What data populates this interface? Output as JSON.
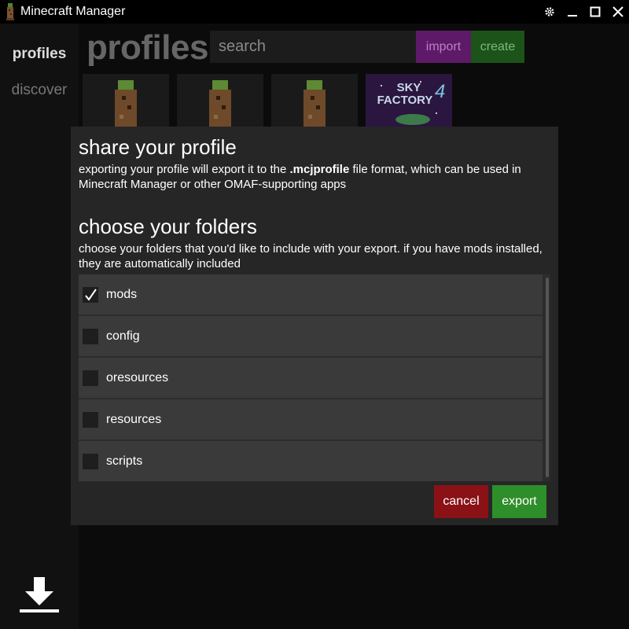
{
  "window": {
    "title": "Minecraft Manager",
    "controls": [
      "gear-icon",
      "minimize-icon",
      "maximize-icon",
      "close-icon"
    ]
  },
  "sidebar": {
    "items": [
      {
        "label": "profiles",
        "active": true
      },
      {
        "label": "discover",
        "active": false
      }
    ],
    "bottom_icon": "download-icon"
  },
  "main": {
    "heading": "profiles",
    "search_placeholder": "search",
    "import_label": "import",
    "create_label": "create",
    "tiles": [
      {
        "icon": "dirt-tree-icon"
      },
      {
        "icon": "dirt-tree-icon"
      },
      {
        "icon": "dirt-tree-icon"
      },
      {
        "icon": "sky-factory-logo",
        "logo_text": "SKY FACTORY 4"
      }
    ]
  },
  "dialog": {
    "title": "share your profile",
    "desc_prefix": "exporting your profile will export it to the ",
    "desc_bold": ".mcjprofile",
    "desc_suffix": " file format, which can be used in Minecraft Manager or other OMAF-supporting apps",
    "folders_title": "choose your folders",
    "folders_desc": "choose your folders that you'd like to include with your export. if you have mods installed, they are automatically included",
    "folders": [
      {
        "label": "mods",
        "checked": true
      },
      {
        "label": "config",
        "checked": false
      },
      {
        "label": "oresources",
        "checked": false
      },
      {
        "label": "resources",
        "checked": false
      },
      {
        "label": "scripts",
        "checked": false
      }
    ],
    "cancel_label": "cancel",
    "export_label": "export"
  },
  "colors": {
    "import_bg": "#5e1a68",
    "create_bg": "#1c5319",
    "cancel_bg": "#8a1116",
    "export_bg": "#2e8e2a",
    "dialog_bg": "#262626"
  }
}
